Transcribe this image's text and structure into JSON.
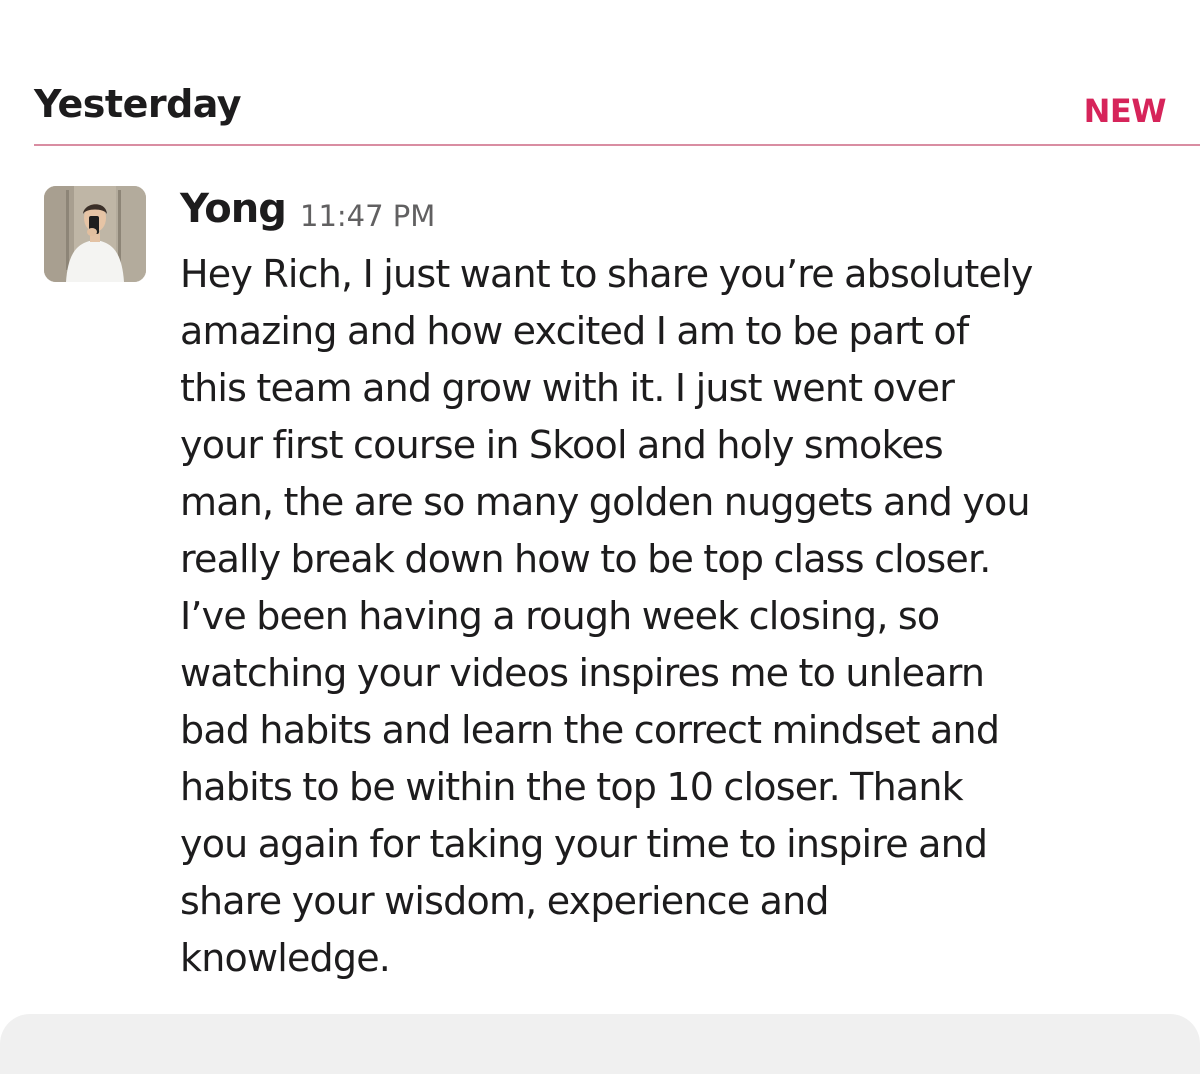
{
  "day_divider": {
    "label": "Yesterday",
    "new_label": "NEW"
  },
  "message": {
    "sender": "Yong",
    "time": "11:47 PM",
    "text": "Hey Rich, I just want to share you’re absolutely\namazing and how excited I am to be part of\nthis team and grow with it. I just went over\nyour first course in Skool and holy smokes\nman, the are so many golden nuggets and you\nreally break down how to be top class closer.\nI’ve been having a rough week closing, so\nwatching your videos inspires me to unlearn\nbad habits and learn the  correct mindset and\nhabits to be within the top 10 closer. Thank\nyou again for taking your time to inspire and\nshare your wisdom, experience and\nknowledge."
  },
  "colors": {
    "new_accent": "#d6245a",
    "divider": "#d98da2",
    "text": "#1d1c1d",
    "muted": "#616061"
  }
}
